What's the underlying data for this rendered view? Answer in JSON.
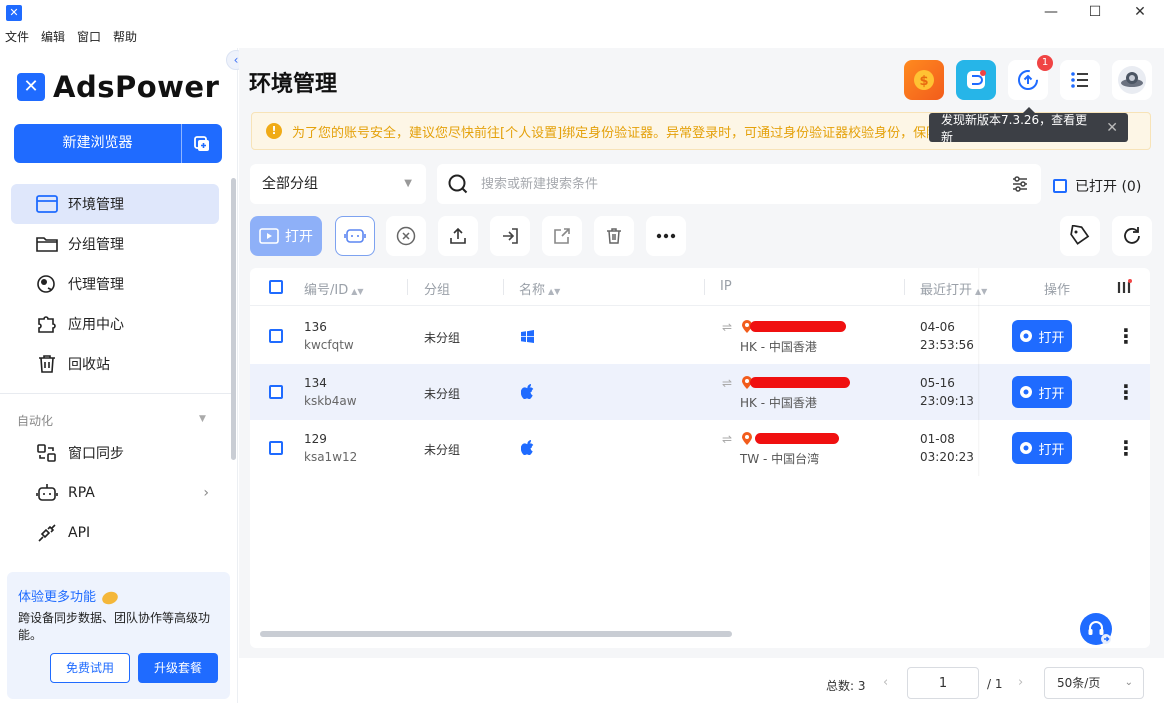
{
  "window": {
    "minimize": "—",
    "maximize": "☐",
    "close": "✕"
  },
  "menu": [
    "文件",
    "编辑",
    "窗口",
    "帮助"
  ],
  "brand": {
    "name": "AdsPower",
    "color": "#1f6bff"
  },
  "sidebar": {
    "new_browser": "新建浏览器",
    "nav": [
      {
        "label": "环境管理",
        "icon": "browser-window-icon",
        "active": true
      },
      {
        "label": "分组管理",
        "icon": "folder-icon"
      },
      {
        "label": "代理管理",
        "icon": "proxy-globe-icon"
      },
      {
        "label": "应用中心",
        "icon": "puzzle-icon"
      },
      {
        "label": "回收站",
        "icon": "trash-icon"
      }
    ],
    "section_label": "自动化",
    "nav2": [
      {
        "label": "窗口同步",
        "icon": "sync-icon"
      },
      {
        "label": "RPA",
        "icon": "robot-icon"
      },
      {
        "label": "API",
        "icon": "plug-icon"
      }
    ],
    "promo": {
      "title": "体验更多功能",
      "desc": "跨设备同步数据、团队协作等高级功能。",
      "trial": "免费试用",
      "upgrade": "升级套餐"
    }
  },
  "header": {
    "title": "环境管理",
    "update_badge": "1",
    "alert": "为了您的账号安全，建议您尽快前往[个人设置]绑定身份验证器。异常登录时，可通过身份验证器校验身份，保障",
    "tooltip": "发现新版本7.3.26，查看更新"
  },
  "filters": {
    "group": "全部分组",
    "search_placeholder": "搜索或新建搜索条件",
    "opened_label": "已打开 (0)"
  },
  "toolbar": {
    "open_label": "打开"
  },
  "table": {
    "columns": {
      "id": "编号/ID",
      "group": "分组",
      "name": "名称",
      "ip": "IP",
      "last_open": "最近打开",
      "actions": "操作"
    },
    "rows": [
      {
        "num": "136",
        "code": "kwcfqtw",
        "group": "未分组",
        "os": "windows",
        "ip_region": "HK - 中国香港",
        "date": "04-06",
        "time": "23:53:56",
        "action": "打开"
      },
      {
        "num": "134",
        "code": "kskb4aw",
        "group": "未分组",
        "os": "apple",
        "ip_region": "HK - 中国香港",
        "date": "05-16",
        "time": "23:09:13",
        "action": "打开"
      },
      {
        "num": "129",
        "code": "ksa1w12",
        "group": "未分组",
        "os": "apple",
        "ip_region": "TW - 中国台湾",
        "date": "01-08",
        "time": "03:20:23",
        "action": "打开"
      }
    ]
  },
  "pagination": {
    "total": "总数: 3",
    "page": "1",
    "of": "/ 1",
    "page_size": "50条/页"
  }
}
